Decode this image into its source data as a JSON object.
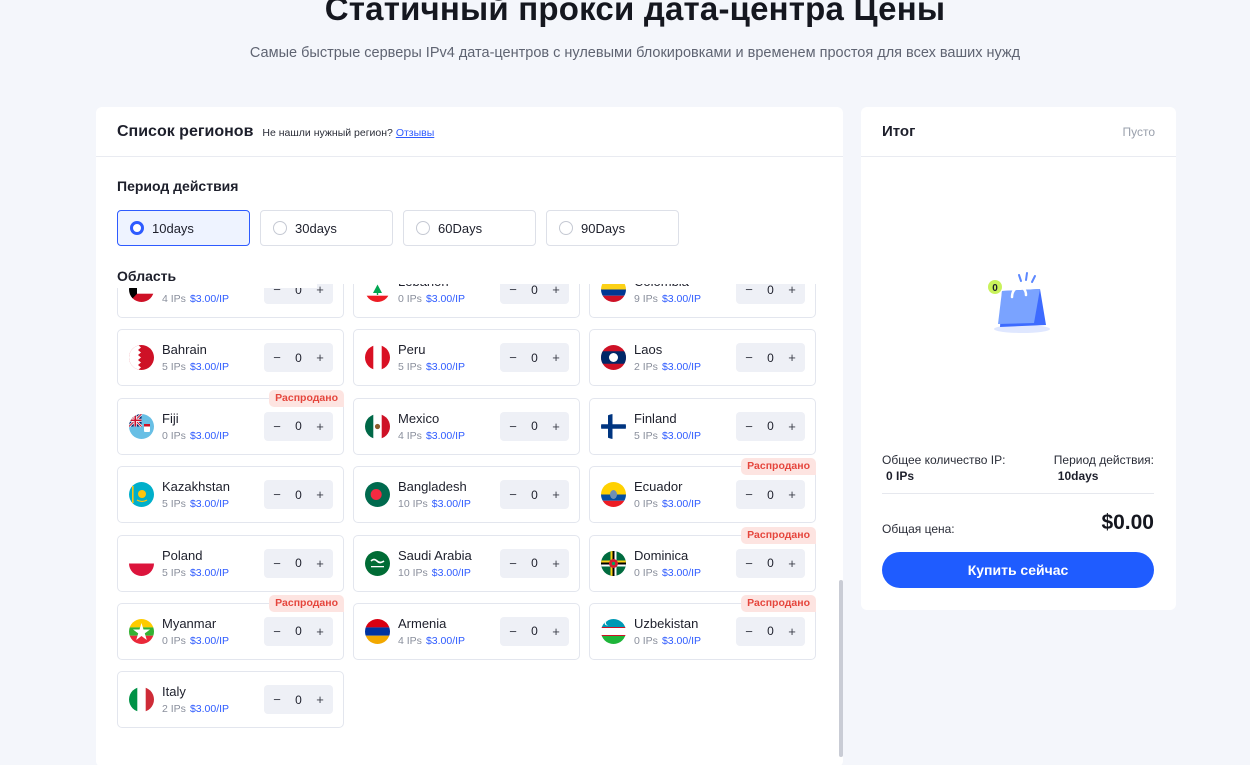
{
  "hero": {
    "title": "Статичный прокси дата-центра Цены",
    "subtitle": "Самые быстрые серверы IPv4 дата-центров с нулевыми блокировками и временем простоя для всех ваших нужд"
  },
  "regions_panel": {
    "title": "Список регионов",
    "hint_text": "Не нашли нужный регион?",
    "hint_link": "Отзывы",
    "period_label": "Период действия",
    "region_label": "Область",
    "periods": [
      {
        "label": "10days",
        "selected": true
      },
      {
        "label": "30days",
        "selected": false
      },
      {
        "label": "60Days",
        "selected": false
      },
      {
        "label": "90Days",
        "selected": false
      }
    ],
    "cards": [
      {
        "name": "Kuwait",
        "ips": "4 IPs",
        "price": "$3.00/IP",
        "qty": "0",
        "soldout": "",
        "flag": "kuwait"
      },
      {
        "name": "Lebanon",
        "ips": "0 IPs",
        "price": "$3.00/IP",
        "qty": "0",
        "soldout": "",
        "flag": "lebanon"
      },
      {
        "name": "Colombia",
        "ips": "9 IPs",
        "price": "$3.00/IP",
        "qty": "0",
        "soldout": "",
        "flag": "colombia"
      },
      {
        "name": "Bahrain",
        "ips": "5 IPs",
        "price": "$3.00/IP",
        "qty": "0",
        "soldout": "",
        "flag": "bahrain"
      },
      {
        "name": "Peru",
        "ips": "5 IPs",
        "price": "$3.00/IP",
        "qty": "0",
        "soldout": "",
        "flag": "peru"
      },
      {
        "name": "Laos",
        "ips": "2 IPs",
        "price": "$3.00/IP",
        "qty": "0",
        "soldout": "",
        "flag": "laos"
      },
      {
        "name": "Fiji",
        "ips": "0 IPs",
        "price": "$3.00/IP",
        "qty": "0",
        "soldout": "Распродано",
        "flag": "fiji"
      },
      {
        "name": "Mexico",
        "ips": "4 IPs",
        "price": "$3.00/IP",
        "qty": "0",
        "soldout": "",
        "flag": "mexico"
      },
      {
        "name": "Finland",
        "ips": "5 IPs",
        "price": "$3.00/IP",
        "qty": "0",
        "soldout": "",
        "flag": "finland"
      },
      {
        "name": "Kazakhstan",
        "ips": "5 IPs",
        "price": "$3.00/IP",
        "qty": "0",
        "soldout": "",
        "flag": "kazakhstan"
      },
      {
        "name": "Bangladesh",
        "ips": "10 IPs",
        "price": "$3.00/IP",
        "qty": "0",
        "soldout": "",
        "flag": "bangladesh"
      },
      {
        "name": "Ecuador",
        "ips": "0 IPs",
        "price": "$3.00/IP",
        "qty": "0",
        "soldout": "Распродано",
        "flag": "ecuador"
      },
      {
        "name": "Poland",
        "ips": "5 IPs",
        "price": "$3.00/IP",
        "qty": "0",
        "soldout": "",
        "flag": "poland"
      },
      {
        "name": "Saudi Arabia",
        "ips": "10 IPs",
        "price": "$3.00/IP",
        "qty": "0",
        "soldout": "",
        "flag": "saudi"
      },
      {
        "name": "Dominica",
        "ips": "0 IPs",
        "price": "$3.00/IP",
        "qty": "0",
        "soldout": "Распродано",
        "flag": "dominica"
      },
      {
        "name": "Myanmar",
        "ips": "0 IPs",
        "price": "$3.00/IP",
        "qty": "0",
        "soldout": "Распродано",
        "flag": "myanmar"
      },
      {
        "name": "Armenia",
        "ips": "4 IPs",
        "price": "$3.00/IP",
        "qty": "0",
        "soldout": "",
        "flag": "armenia"
      },
      {
        "name": "Uzbekistan",
        "ips": "0 IPs",
        "price": "$3.00/IP",
        "qty": "0",
        "soldout": "Распродано",
        "flag": "uzbekistan"
      },
      {
        "name": "Italy",
        "ips": "2 IPs",
        "price": "$3.00/IP",
        "qty": "0",
        "soldout": "",
        "flag": "italy"
      }
    ],
    "stepper_minus": "−",
    "stepper_plus": "+"
  },
  "summary": {
    "title": "Итог",
    "empty_label": "Пусто",
    "cart_badge": "0",
    "total_ips_label": "Общее количество IP:",
    "total_ips_value": "0 IPs",
    "period_label": "Период действия:",
    "period_value": "10days",
    "total_price_label": "Общая цена:",
    "total_price_value": "$0.00",
    "buy_button": "Купить сейчас"
  },
  "colors": {
    "accent": "#1f5cff",
    "soldout_bg": "#fde4e1",
    "soldout_text": "#e5463d"
  }
}
